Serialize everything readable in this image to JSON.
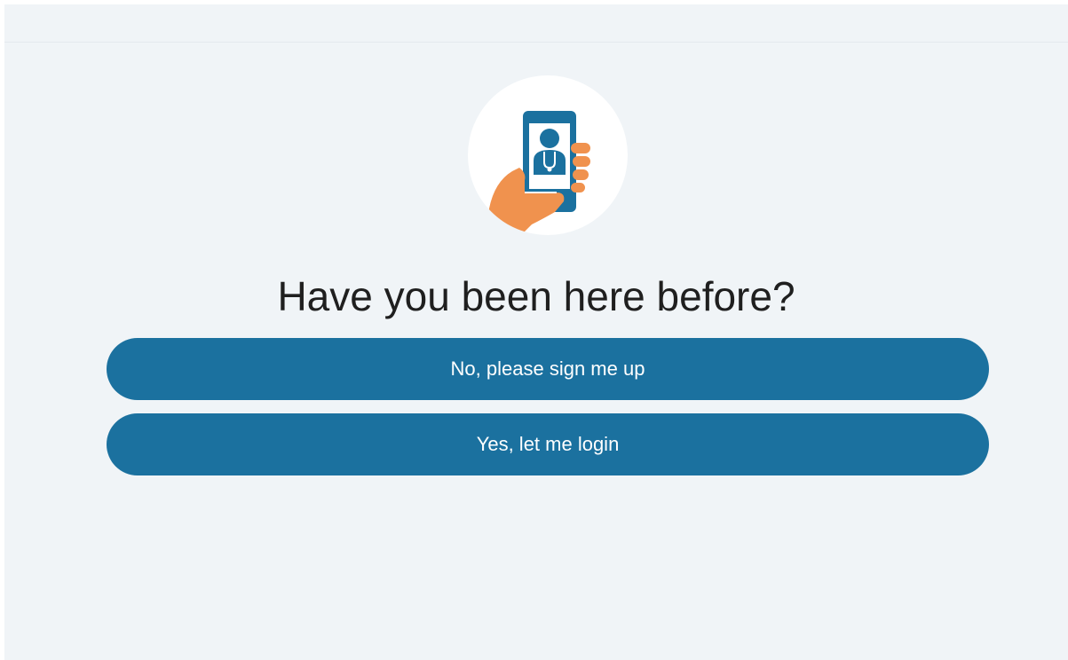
{
  "header": {},
  "hero": {
    "icon": "hand-holding-phone-doctor-icon",
    "colors": {
      "phone": "#1b719f",
      "hand": "#f0924e",
      "circle": "#ffffff"
    }
  },
  "main": {
    "heading": "Have you been here before?",
    "signup_label": "No, please sign me up",
    "login_label": "Yes, let me login"
  },
  "theme": {
    "background": "#f0f4f7",
    "button_color": "#1b719f",
    "button_text_color": "#ffffff"
  }
}
